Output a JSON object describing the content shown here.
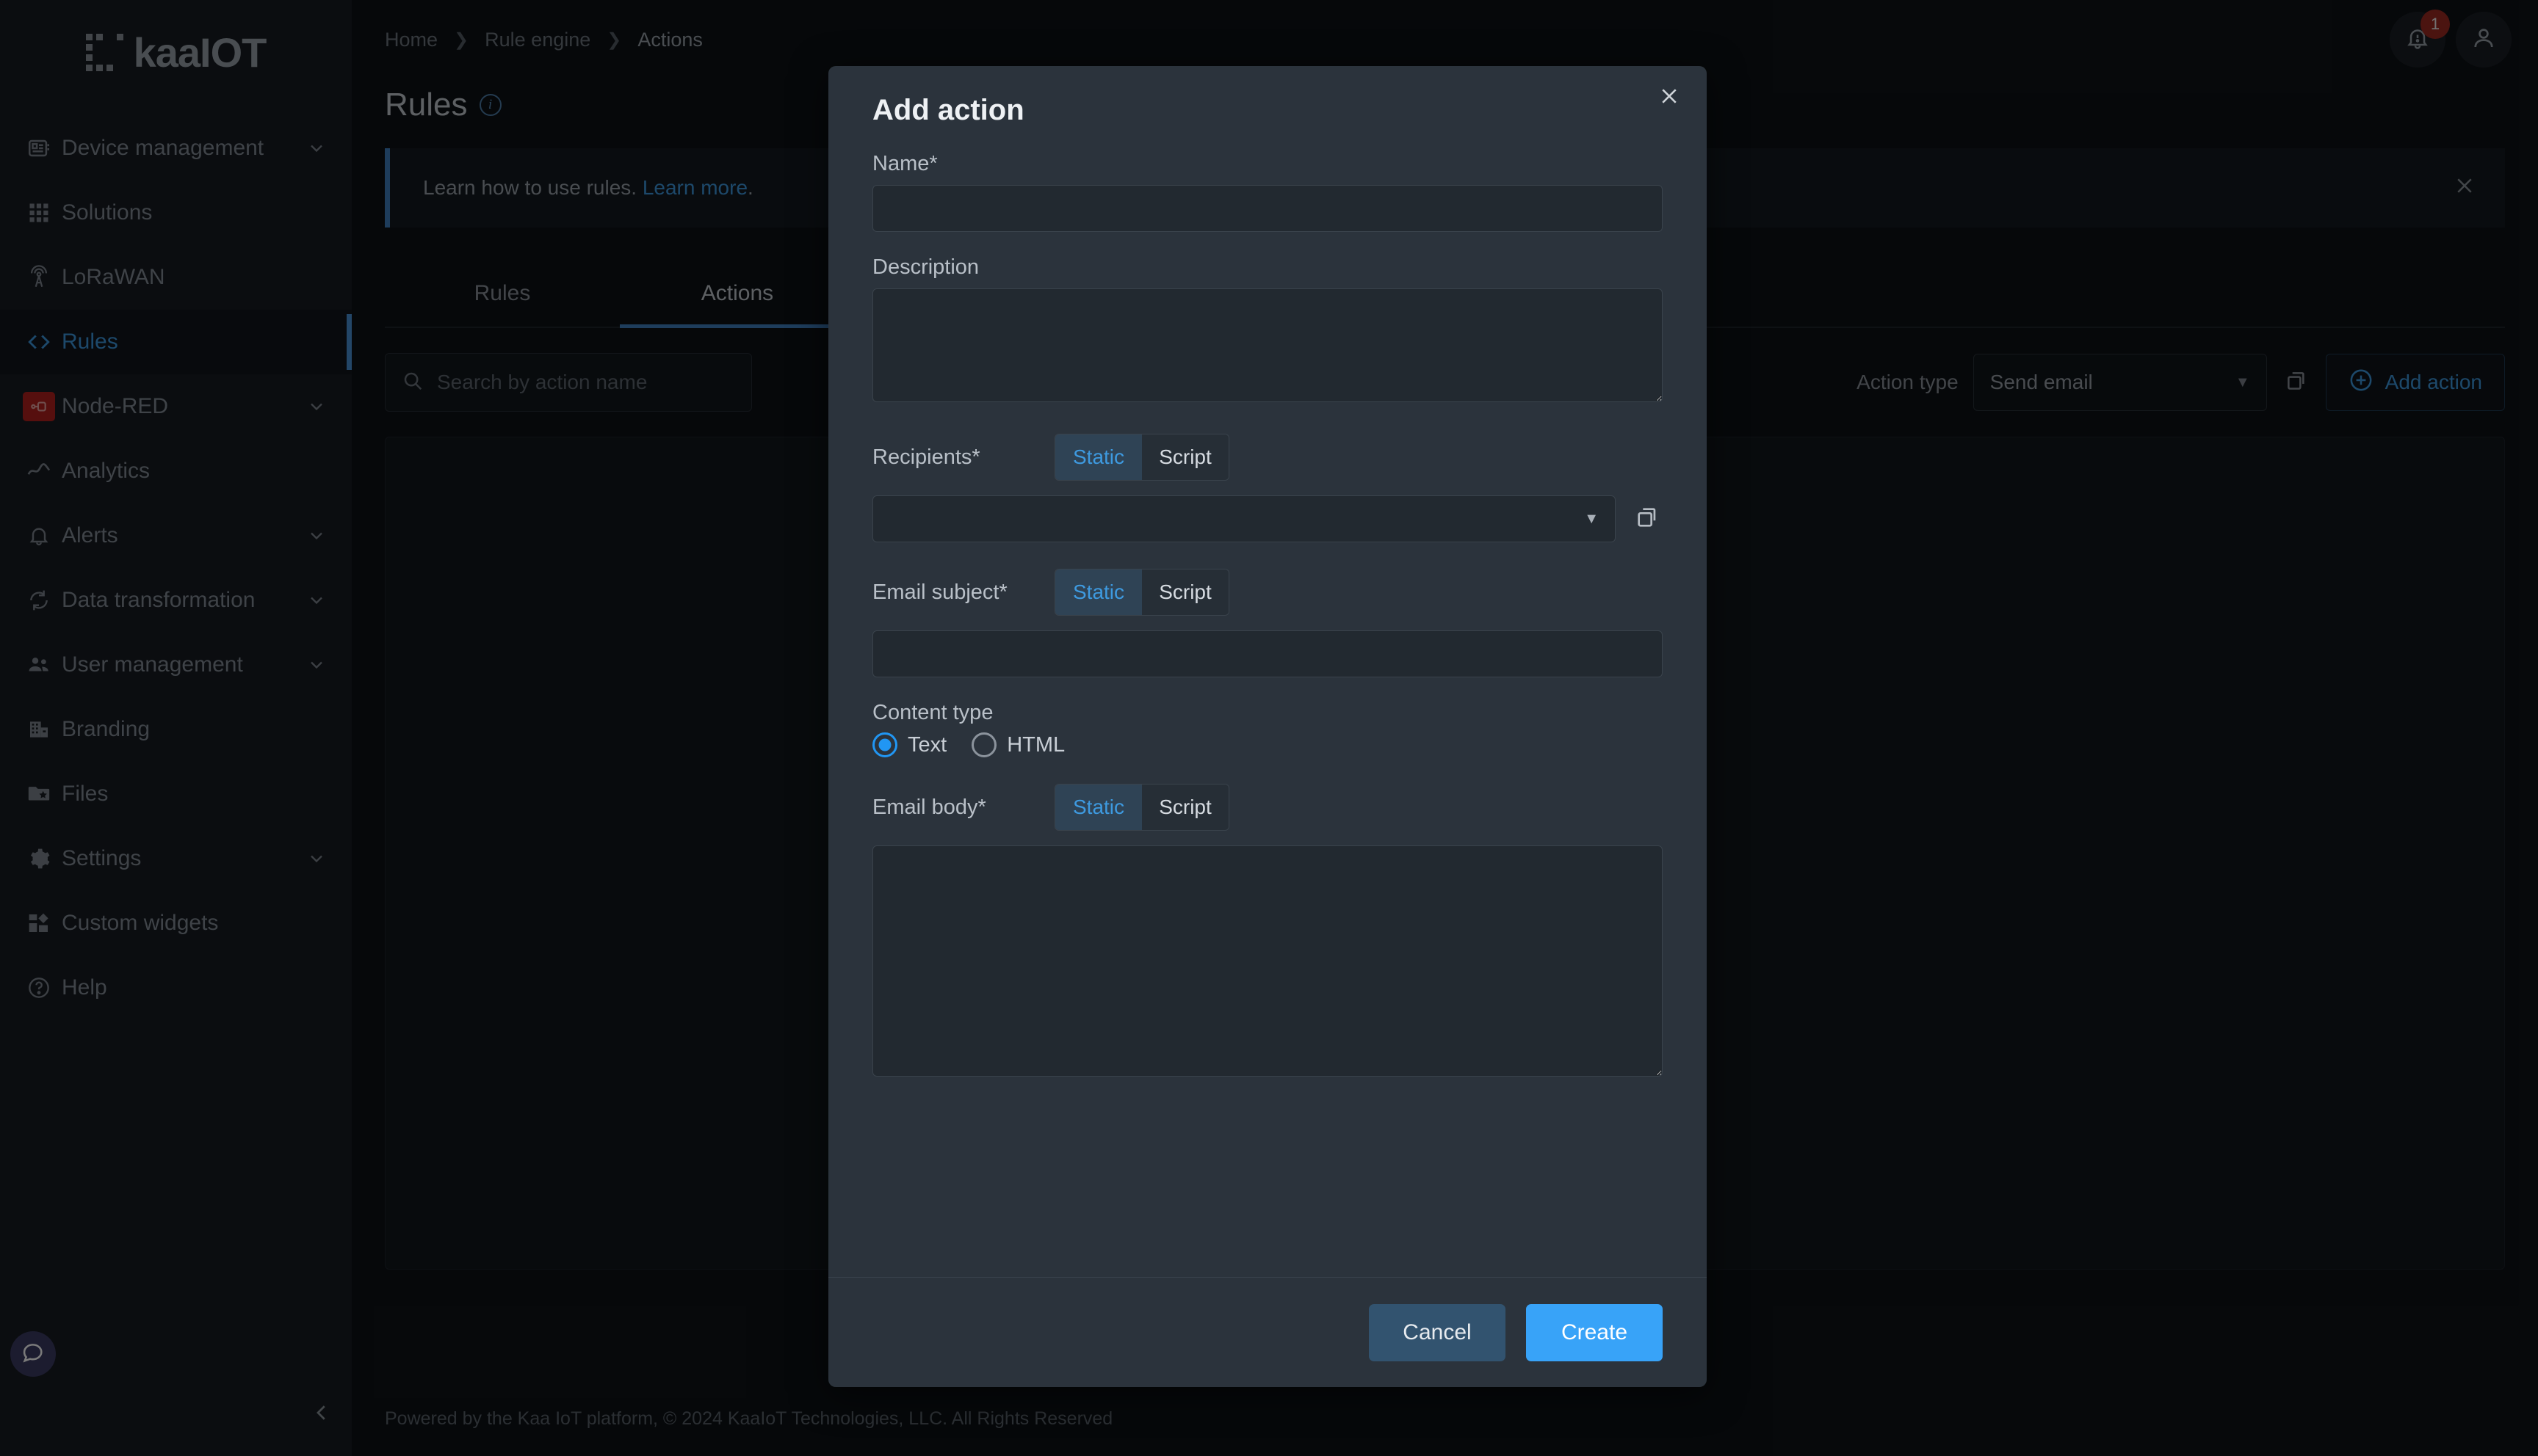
{
  "brand": {
    "logo_text": "kaaIOT"
  },
  "sidebar": {
    "items": [
      {
        "label": "Device management",
        "icon": "chip-icon",
        "expandable": true
      },
      {
        "label": "Solutions",
        "icon": "grid-icon",
        "expandable": false
      },
      {
        "label": "LoRaWAN",
        "icon": "antenna-icon",
        "expandable": false
      },
      {
        "label": "Rules",
        "icon": "code-brackets-icon",
        "expandable": false,
        "active": true
      },
      {
        "label": "Node-RED",
        "icon": "node-red-icon",
        "expandable": true
      },
      {
        "label": "Analytics",
        "icon": "analytics-icon",
        "expandable": false
      },
      {
        "label": "Alerts",
        "icon": "bell-icon",
        "expandable": true
      },
      {
        "label": "Data transformation",
        "icon": "transform-icon",
        "expandable": true
      },
      {
        "label": "User management",
        "icon": "people-icon",
        "expandable": true
      },
      {
        "label": "Branding",
        "icon": "building-icon",
        "expandable": false
      },
      {
        "label": "Files",
        "icon": "folder-star-icon",
        "expandable": false
      },
      {
        "label": "Settings",
        "icon": "gear-icon",
        "expandable": true
      },
      {
        "label": "Custom widgets",
        "icon": "widgets-icon",
        "expandable": false
      },
      {
        "label": "Help",
        "icon": "help-circle-icon",
        "expandable": false
      }
    ]
  },
  "topbar": {
    "breadcrumb": [
      "Home",
      "Rule engine",
      "Actions"
    ],
    "notification_count": "1"
  },
  "page": {
    "title": "Rules",
    "banner_text": "Learn how to use rules.",
    "banner_link": "Learn more",
    "banner_suffix": ".",
    "tabs": [
      {
        "label": "Rules",
        "active": false
      },
      {
        "label": "Actions",
        "active": true
      }
    ],
    "search": {
      "placeholder": "Search by action name",
      "value": ""
    },
    "action_type_label": "Action type",
    "action_type_value": "Send email",
    "add_action_label": "Add action",
    "footer": "Powered by the Kaa IoT platform, © 2024 KaaIoT Technologies, LLC. All Rights Reserved"
  },
  "modal": {
    "title": "Add action",
    "name": {
      "label": "Name*",
      "value": "",
      "placeholder": ""
    },
    "description": {
      "label": "Description",
      "value": "",
      "placeholder": ""
    },
    "recipients": {
      "label": "Recipients*",
      "modes": [
        "Static",
        "Script"
      ],
      "selected_mode": "Static",
      "value": ""
    },
    "email_subject": {
      "label": "Email subject*",
      "modes": [
        "Static",
        "Script"
      ],
      "selected_mode": "Static",
      "value": ""
    },
    "content_type": {
      "label": "Content type",
      "options": [
        "Text",
        "HTML"
      ],
      "selected": "Text"
    },
    "email_body": {
      "label": "Email body*",
      "modes": [
        "Static",
        "Script"
      ],
      "selected_mode": "Static",
      "value": ""
    },
    "cancel_label": "Cancel",
    "create_label": "Create"
  },
  "colors": {
    "accent_blue": "#3e9ae0",
    "primary_button": "#38a3f8",
    "cancel_button": "#32536f",
    "modal_bg": "#2b333c",
    "page_bg": "#0e1216",
    "sidebar_bg": "#171c22",
    "alert_red": "#9e2a22",
    "node_red": "#b3211e"
  }
}
